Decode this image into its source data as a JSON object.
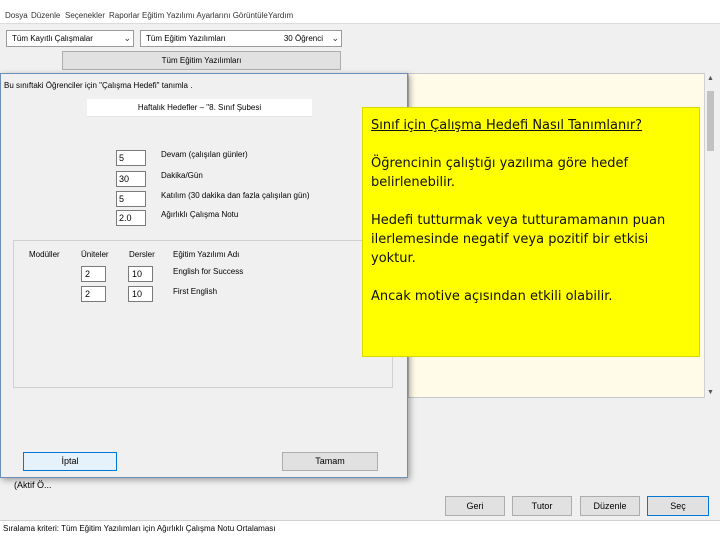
{
  "menu": [
    "Dosya",
    "Düzenle",
    "Seçenekler",
    "Raporlar",
    "Eğitim Yazılımı Ayarlarını Görüntüle",
    "Yardım"
  ],
  "filters": {
    "students_combo": "Tüm Kayıtlı Çalışmalar",
    "software_combo": "Tüm Eğitim Yazılımları",
    "software_count": "30 Öğrenci",
    "all_software_button": "Tüm Eğitim Yazılımları"
  },
  "dialog": {
    "title": "Bu sınıftaki Öğrenciler için \"Çalışma Hedefi\" tanımla .",
    "target_header": "Haftalık Hedefler – \"8. Sınıf Şubesi",
    "fields": [
      {
        "value": "5",
        "label": "Devam (çalışılan günler)"
      },
      {
        "value": "30",
        "label": "Dakika/Gün"
      },
      {
        "value": "5",
        "label": "Katılım (30 dakika dan fazla çalışılan gün)"
      },
      {
        "value": "2.0",
        "label": "Ağırlıklı Çalışma Notu"
      }
    ],
    "table_headers": {
      "modules": "Modüller",
      "units": "Üniteler",
      "lessons": "Dersler",
      "software_name": "Eğitim Yazılımı Adı"
    },
    "rows": [
      {
        "units": "2",
        "lessons": "10",
        "name": "English for Success"
      },
      {
        "units": "2",
        "lessons": "10",
        "name": "First English"
      }
    ],
    "cancel_label": "İptal",
    "ok_label": "Tamam"
  },
  "callout": {
    "heading": "Sınıf için Çalışma Hedefi Nasıl Tanımlanır?",
    "para1": "Öğrencinin çalıştığı yazılıma göre hedef belirlenebilir.",
    "para2": "Hedefi tutturmak veya tutturamamanın puan ilerlemesinde negatif veya  pozitif bir etkisi yoktur.",
    "para3": "Ancak motive açısından etkili olabilir."
  },
  "footer": {
    "active_label": "(Aktif Ö...",
    "buttons": {
      "back": "Geri",
      "tutor": "Tutor",
      "edit": "Düzenle",
      "next": "Seç"
    },
    "status": "Sıralama kriteri: Tüm Eğitim Yazılımları için Ağırlıklı Çalışma Notu Ortalaması"
  }
}
